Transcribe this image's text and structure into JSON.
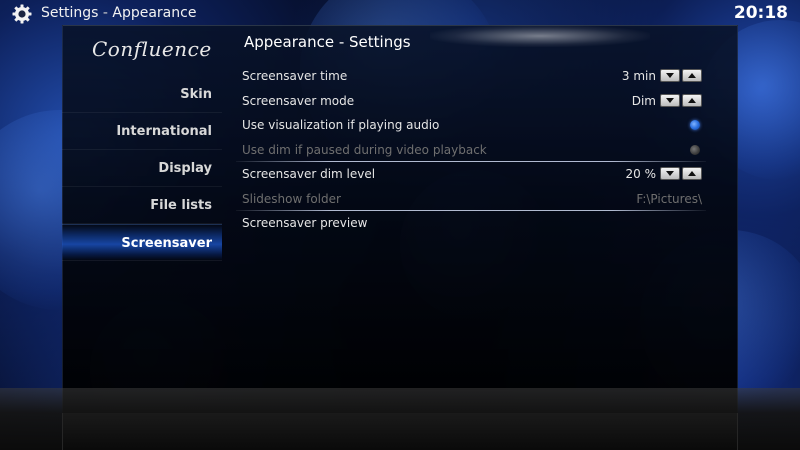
{
  "header": {
    "section": "Settings",
    "separator": " - ",
    "page": "Appearance",
    "clock": "20:18"
  },
  "skin": {
    "logo_text": "Confluence"
  },
  "sidebar": {
    "items": [
      {
        "label": "Skin"
      },
      {
        "label": "International"
      },
      {
        "label": "Display"
      },
      {
        "label": "File lists"
      },
      {
        "label": "Screensaver",
        "active": true
      }
    ]
  },
  "content": {
    "title": "Appearance - Settings",
    "settings": [
      {
        "label": "Screensaver time",
        "value": "3 min",
        "control": "spinner"
      },
      {
        "label": "Screensaver mode",
        "value": "Dim",
        "control": "spinner"
      },
      {
        "label": "Use visualization if playing audio",
        "control": "radio",
        "checked": true
      },
      {
        "label": "Use dim if paused during video playback",
        "control": "radio",
        "checked": false,
        "disabled": true
      },
      {
        "label": "Screensaver dim level",
        "value": "20 %",
        "control": "spinner"
      },
      {
        "label": "Slideshow folder",
        "value": "F:\\Pictures\\",
        "control": "text",
        "disabled": true
      },
      {
        "label": "Screensaver preview",
        "control": "button"
      }
    ]
  },
  "icons": {
    "settings": "gear-icon",
    "spinner_down": "arrow-down-icon",
    "spinner_up": "arrow-up-icon"
  },
  "colors": {
    "accent": "#2a6fe0",
    "background": "#040a1e",
    "disabled_text": "#6f6f6f"
  }
}
